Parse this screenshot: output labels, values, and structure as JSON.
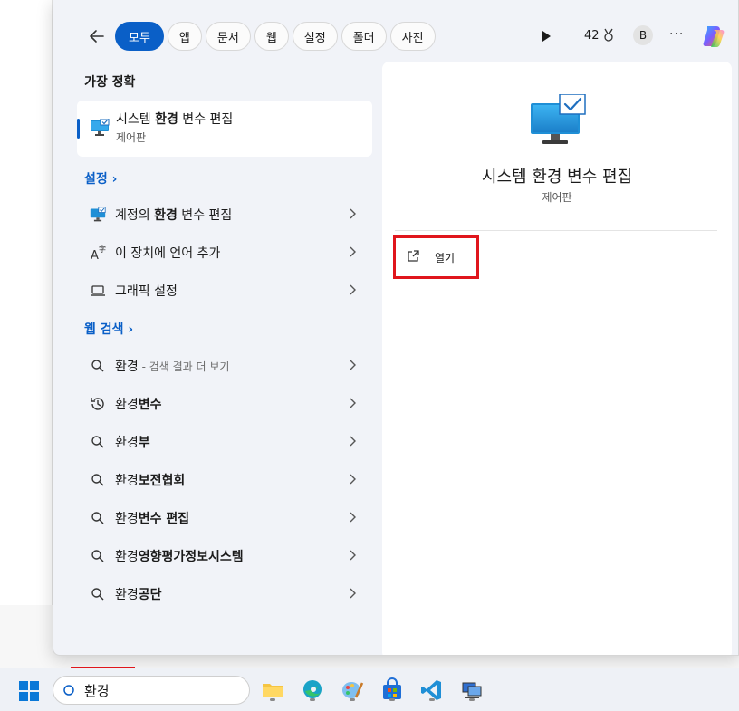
{
  "filters": {
    "back_label": "뒤로",
    "chips": [
      "모두",
      "앱",
      "문서",
      "웹",
      "설정",
      "폴더",
      "사진"
    ],
    "active_chip": "모두",
    "points": "42",
    "avatar_initial": "B",
    "more_label": "···"
  },
  "best_match": {
    "section_title": "가장 정확",
    "title_pre": "시스템 ",
    "title_bold": "환경",
    "title_post": " 변수 편집",
    "subtitle": "제어판"
  },
  "settings": {
    "section_title": "설정 ›",
    "items": [
      {
        "pre": "계정의 ",
        "bold": "환경",
        "post": " 변수 편집",
        "icon": "monitor-icon"
      },
      {
        "pre": "이 장치에 언어 추가",
        "bold": "",
        "post": "",
        "icon": "language-icon"
      },
      {
        "pre": "그래픽 설정",
        "bold": "",
        "post": "",
        "icon": "laptop-icon"
      }
    ]
  },
  "web": {
    "section_title": "웹 검색 ›",
    "items": [
      {
        "pre": "환경",
        "bold": "",
        "hint": " - 검색 결과 더 보기",
        "icon": "search-icon"
      },
      {
        "pre": "환경",
        "bold": "변수",
        "hint": "",
        "icon": "history-icon"
      },
      {
        "pre": "환경",
        "bold": "부",
        "hint": "",
        "icon": "search-icon"
      },
      {
        "pre": "환경",
        "bold": "보전협회",
        "hint": "",
        "icon": "search-icon"
      },
      {
        "pre": "환경",
        "bold": "변수 편집",
        "hint": "",
        "icon": "search-icon"
      },
      {
        "pre": "환경",
        "bold": "영향평가정보시스템",
        "hint": "",
        "icon": "search-icon"
      },
      {
        "pre": "환경",
        "bold": "공단",
        "hint": "",
        "icon": "search-icon"
      }
    ]
  },
  "detail": {
    "title": "시스템 환경 변수 편집",
    "subtitle": "제어판",
    "open_label": "열기"
  },
  "taskbar": {
    "search_value": "환경",
    "apps": [
      "file-explorer-icon",
      "edge-icon",
      "paint-icon",
      "store-icon",
      "vscode-icon",
      "network-icon"
    ]
  },
  "colors": {
    "accent": "#0a5fc7",
    "highlight": "#e0161c"
  }
}
